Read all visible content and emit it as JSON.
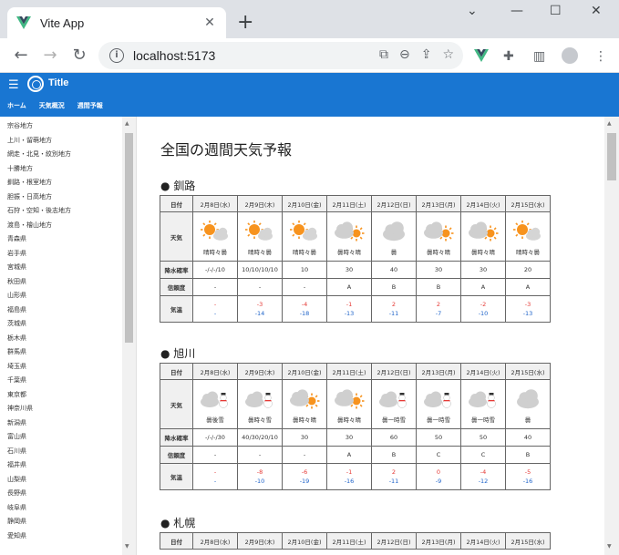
{
  "browser": {
    "tab_title": "Vite App",
    "url": "localhost:5173"
  },
  "app": {
    "title": "Title",
    "nav": [
      "ホーム",
      "天気概況",
      "週間予報"
    ]
  },
  "sidebar": {
    "items": [
      "宗谷地方",
      "上川・留萌地方",
      "網走・北見・紋別地方",
      "十勝地方",
      "釧路・根室地方",
      "胆振・日高地方",
      "石狩・空知・後志地方",
      "渡島・檜山地方",
      "青森県",
      "岩手県",
      "宮城県",
      "秋田県",
      "山形県",
      "福島県",
      "茨城県",
      "栃木県",
      "群馬県",
      "埼玉県",
      "千葉県",
      "東京都",
      "神奈川県",
      "新潟県",
      "富山県",
      "石川県",
      "福井県",
      "山梨県",
      "長野県",
      "岐阜県",
      "静岡県",
      "愛知県"
    ]
  },
  "main": {
    "page_title": "全国の週間天気予報",
    "row_labels": {
      "date": "日付",
      "weather": "天気",
      "rain": "降水確率",
      "reliability": "信頼度",
      "temp": "気温"
    },
    "cities": [
      {
        "name": "● 釧路",
        "days": [
          {
            "date": "2月8日(水)",
            "icon": "sun-cloud",
            "weather": "晴時々曇",
            "rain": "-/-/-/10",
            "rel": "-",
            "hi": "-",
            "lo": "-"
          },
          {
            "date": "2月9日(木)",
            "icon": "sun-cloud",
            "weather": "晴時々曇",
            "rain": "10/10/10/10",
            "rel": "-",
            "hi": "-3",
            "lo": "-14"
          },
          {
            "date": "2月10日(金)",
            "icon": "sun-cloud",
            "weather": "晴時々曇",
            "rain": "10",
            "rel": "-",
            "hi": "-4",
            "lo": "-18"
          },
          {
            "date": "2月11日(土)",
            "icon": "cloud-sun",
            "weather": "曇時々晴",
            "rain": "30",
            "rel": "A",
            "hi": "-1",
            "lo": "-13"
          },
          {
            "date": "2月12日(日)",
            "icon": "cloud",
            "weather": "曇",
            "rain": "40",
            "rel": "B",
            "hi": "2",
            "lo": "-11"
          },
          {
            "date": "2月13日(月)",
            "icon": "cloud-sun",
            "weather": "曇時々晴",
            "rain": "30",
            "rel": "B",
            "hi": "2",
            "lo": "-7"
          },
          {
            "date": "2月14日(火)",
            "icon": "cloud-sun",
            "weather": "曇時々晴",
            "rain": "30",
            "rel": "A",
            "hi": "-2",
            "lo": "-10"
          },
          {
            "date": "2月15日(水)",
            "icon": "sun-cloud",
            "weather": "晴時々曇",
            "rain": "20",
            "rel": "A",
            "hi": "-3",
            "lo": "-13"
          }
        ]
      },
      {
        "name": "● 旭川",
        "days": [
          {
            "date": "2月8日(水)",
            "icon": "cloud-snow",
            "weather": "曇後雪",
            "rain": "-/-/-/30",
            "rel": "-",
            "hi": "-",
            "lo": "-"
          },
          {
            "date": "2月9日(木)",
            "icon": "cloud-snow",
            "weather": "曇時々雪",
            "rain": "40/30/20/10",
            "rel": "-",
            "hi": "-8",
            "lo": "-10"
          },
          {
            "date": "2月10日(金)",
            "icon": "cloud-sun",
            "weather": "曇時々晴",
            "rain": "30",
            "rel": "-",
            "hi": "-6",
            "lo": "-19"
          },
          {
            "date": "2月11日(土)",
            "icon": "cloud-sun",
            "weather": "曇時々晴",
            "rain": "30",
            "rel": "A",
            "hi": "-1",
            "lo": "-16"
          },
          {
            "date": "2月12日(日)",
            "icon": "cloud-snow",
            "weather": "曇一時雪",
            "rain": "60",
            "rel": "B",
            "hi": "2",
            "lo": "-11"
          },
          {
            "date": "2月13日(月)",
            "icon": "cloud-snow",
            "weather": "曇一時雪",
            "rain": "50",
            "rel": "C",
            "hi": "0",
            "lo": "-9"
          },
          {
            "date": "2月14日(火)",
            "icon": "cloud-snow",
            "weather": "曇一時雪",
            "rain": "50",
            "rel": "C",
            "hi": "-4",
            "lo": "-12"
          },
          {
            "date": "2月15日(水)",
            "icon": "cloud",
            "weather": "曇",
            "rain": "40",
            "rel": "B",
            "hi": "-5",
            "lo": "-16"
          }
        ]
      },
      {
        "name": "● 札幌",
        "days": [
          {
            "date": "2月8日(水)"
          },
          {
            "date": "2月9日(木)"
          },
          {
            "date": "2月10日(金)"
          },
          {
            "date": "2月11日(土)"
          },
          {
            "date": "2月12日(日)"
          },
          {
            "date": "2月13日(月)"
          },
          {
            "date": "2月14日(火)"
          },
          {
            "date": "2月15日(水)"
          }
        ]
      }
    ]
  },
  "colors": {
    "appbar": "#1976d2",
    "hi_temp": "#e53935",
    "lo_temp": "#1e63c9",
    "sun": "#f7931e",
    "cloud": "#cfcfcf"
  }
}
